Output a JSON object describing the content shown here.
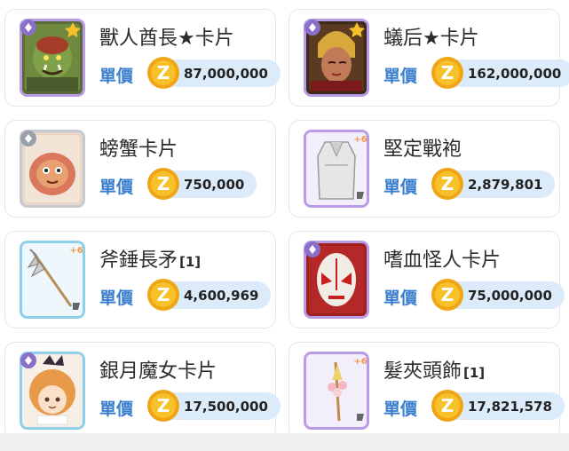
{
  "price_label": "單價",
  "items": [
    {
      "name": "獸人酋長★卡片",
      "slots": "",
      "price": "87,000,000",
      "frame": "purple",
      "icon": "orc-chief-card-icon",
      "badge": "card-icon"
    },
    {
      "name": "蟻后★卡片",
      "slots": "",
      "price": "162,000,000",
      "frame": "purple",
      "icon": "ant-queen-card-icon",
      "badge": "card-icon"
    },
    {
      "name": "螃蟹卡片",
      "slots": "",
      "price": "750,000",
      "frame": "gray",
      "icon": "crab-card-icon",
      "badge": "card-icon"
    },
    {
      "name": "堅定戰袍",
      "slots": "",
      "price": "2,879,801",
      "frame": "purple",
      "icon": "robe-icon",
      "badge": "+6"
    },
    {
      "name": "斧錘長矛",
      "slots": "[1]",
      "price": "4,600,969",
      "frame": "blue",
      "icon": "halberd-icon",
      "badge": "+6"
    },
    {
      "name": "嗜血怪人卡片",
      "slots": "",
      "price": "75,000,000",
      "frame": "purple",
      "icon": "bloody-mask-card-icon",
      "badge": "card-icon"
    },
    {
      "name": "銀月魔女卡片",
      "slots": "",
      "price": "17,500,000",
      "frame": "blue",
      "icon": "silver-moon-witch-card-icon",
      "badge": "card-icon"
    },
    {
      "name": "髮夾頭飾",
      "slots": "[1]",
      "price": "17,821,578",
      "frame": "purple",
      "icon": "hairpin-icon",
      "badge": "+6"
    }
  ],
  "colors": {
    "purple_frame": "#b89ae6",
    "blue_frame": "#8ed0ea",
    "gray_frame": "#c6c9cf",
    "price_label": "#3b7fd0",
    "pill_bg": "#dcebfa",
    "zeny_gold": "#f5b71c"
  }
}
